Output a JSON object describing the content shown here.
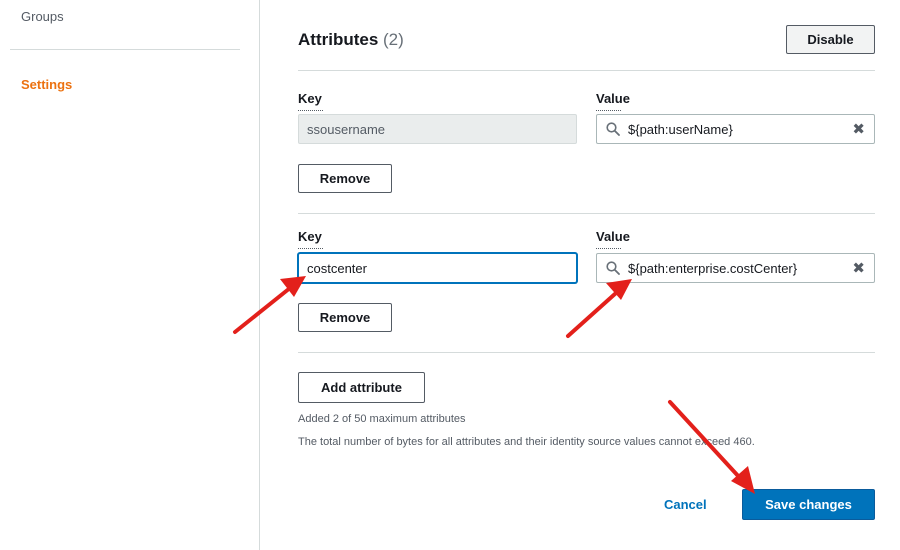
{
  "sidebar": {
    "items": [
      {
        "label": "Groups"
      },
      {
        "label": "Settings"
      }
    ]
  },
  "attributes": {
    "title": "Attributes",
    "count": "(2)",
    "disable_label": "Disable",
    "key_label": "Key",
    "value_label": "Value",
    "rows": [
      {
        "key": "ssousername",
        "value": "${path:userName}",
        "remove_label": "Remove"
      },
      {
        "key": "costcenter",
        "value": "${path:enterprise.costCenter}",
        "remove_label": "Remove"
      }
    ],
    "add_label": "Add attribute",
    "limit_note": "Added 2 of 50 maximum attributes",
    "bytes_note": "The total number of bytes for all attributes and their identity source values cannot exceed 460."
  },
  "footer": {
    "cancel_label": "Cancel",
    "save_label": "Save changes"
  },
  "colors": {
    "accent_orange": "#ec7211",
    "primary_blue": "#0073bb",
    "annotation_red": "#e3201b"
  },
  "icons": [
    "search-icon",
    "clear-icon",
    "annotation-arrow"
  ]
}
